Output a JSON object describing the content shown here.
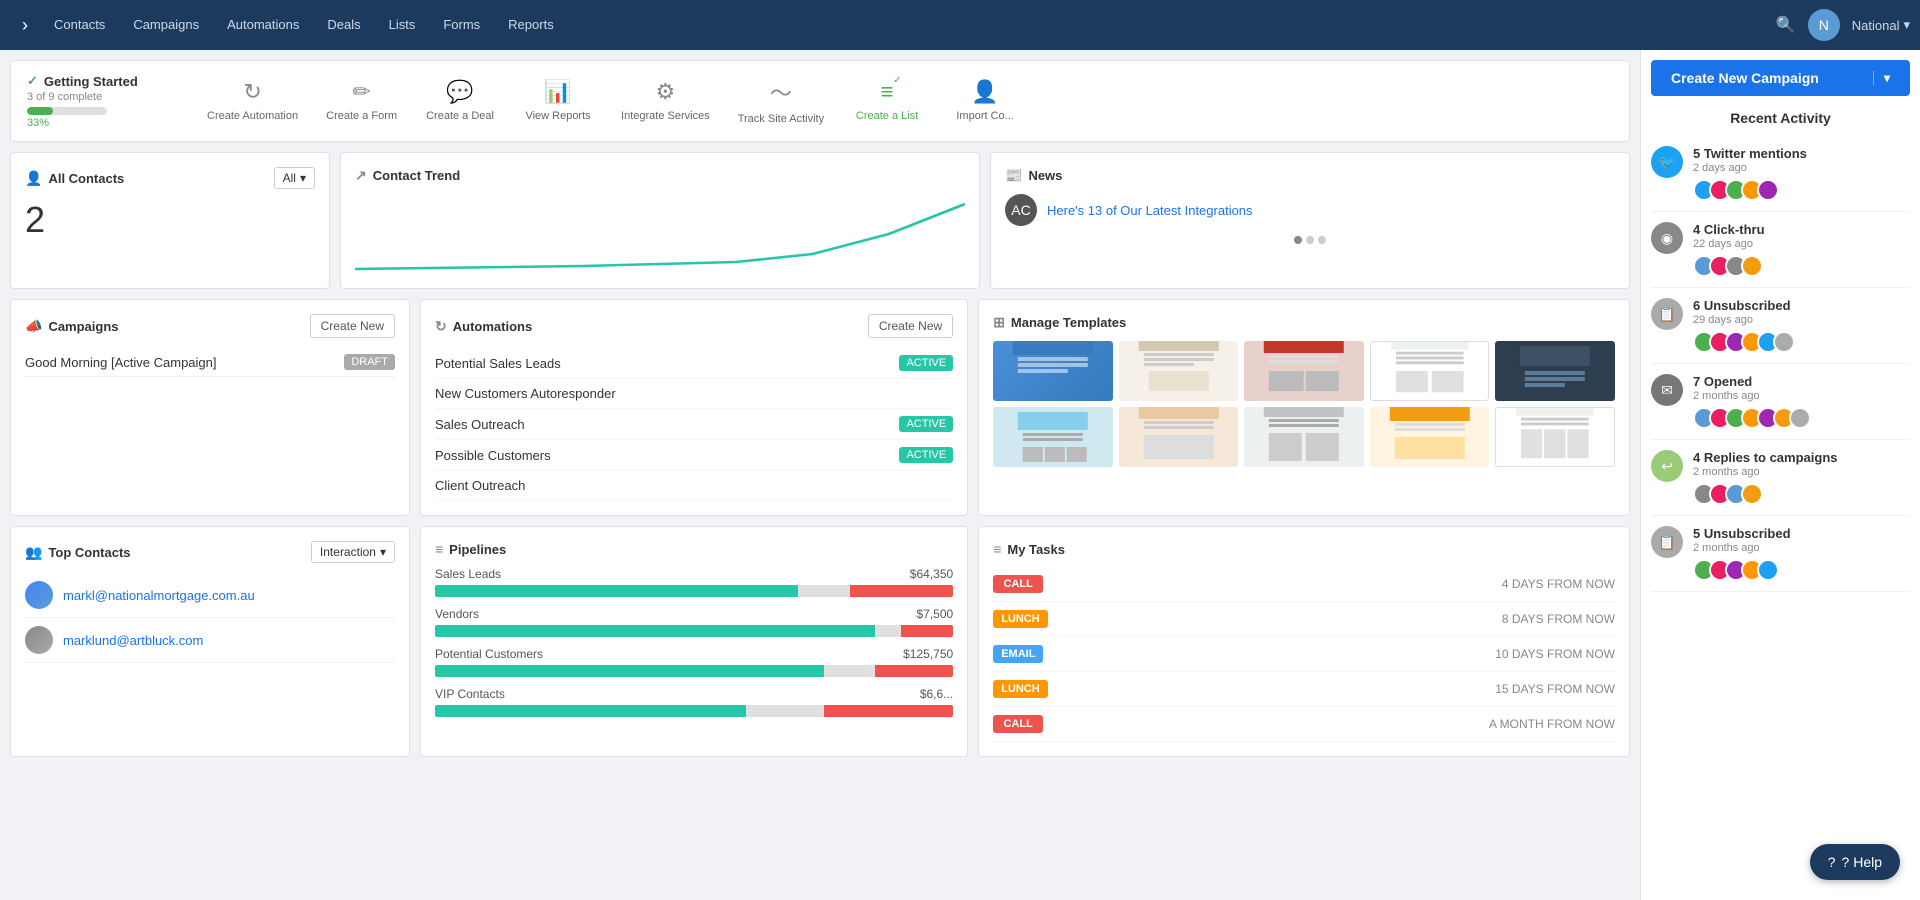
{
  "nav": {
    "toggle_icon": "›",
    "links": [
      "Contacts",
      "Campaigns",
      "Automations",
      "Deals",
      "Lists",
      "Forms",
      "Reports"
    ],
    "org": "National",
    "org_arrow": "▾"
  },
  "getting_started": {
    "title": "Getting Started",
    "progress_text": "3 of 9 complete",
    "progress_pct": 33,
    "progress_label": "33%",
    "steps": [
      {
        "icon": "↻",
        "label": "Create Automation",
        "done": false
      },
      {
        "icon": "✏",
        "label": "Create a Form",
        "done": false
      },
      {
        "icon": "💬",
        "label": "Create a Deal",
        "done": false
      },
      {
        "icon": "📊",
        "label": "View Reports",
        "done": false
      },
      {
        "icon": "⚙",
        "label": "Integrate Services",
        "done": false
      },
      {
        "icon": "〜",
        "label": "Track Site Activity",
        "done": false
      },
      {
        "icon": "≡",
        "label": "Create a List",
        "done": true
      },
      {
        "icon": "👤",
        "label": "Import Co...",
        "done": false
      }
    ]
  },
  "all_contacts": {
    "title": "All Contacts",
    "filter_value": "All",
    "count": "2"
  },
  "contact_trend": {
    "title": "Contact Trend"
  },
  "news": {
    "title": "News",
    "item_text": "Here's 13 of Our Latest Integrations"
  },
  "campaigns": {
    "title": "Campaigns",
    "create_label": "Create New",
    "items": [
      {
        "name": "Good Morning [Active Campaign]",
        "badge": "DRAFT",
        "badge_type": "draft"
      }
    ]
  },
  "automations": {
    "title": "Automations",
    "create_label": "Create New",
    "items": [
      {
        "name": "Potential Sales Leads",
        "badge": "ACTIVE",
        "badge_type": "active"
      },
      {
        "name": "New Customers Autoresponder",
        "badge": "",
        "badge_type": "none"
      },
      {
        "name": "Sales Outreach",
        "badge": "ACTIVE",
        "badge_type": "active"
      },
      {
        "name": "Possible Customers",
        "badge": "ACTIVE",
        "badge_type": "active"
      },
      {
        "name": "Client Outreach",
        "badge": "",
        "badge_type": "none"
      }
    ]
  },
  "manage_templates": {
    "title": "Manage Templates",
    "templates": [
      {
        "color": "#4a90d9",
        "pattern": "blue"
      },
      {
        "color": "#e8e0d0",
        "pattern": "tan"
      },
      {
        "color": "#c0392b",
        "pattern": "red"
      },
      {
        "color": "#ecf0f1",
        "pattern": "light"
      },
      {
        "color": "#2c3e50",
        "pattern": "dark"
      },
      {
        "color": "#87ceeb",
        "pattern": "sky"
      },
      {
        "color": "#e8d5c0",
        "pattern": "peach"
      },
      {
        "color": "#bdc3c7",
        "pattern": "gray"
      },
      {
        "color": "#f39c12",
        "pattern": "orange"
      },
      {
        "color": "#ecf0f1",
        "pattern": "white"
      }
    ]
  },
  "top_contacts": {
    "title": "Top Contacts",
    "filter_value": "Interaction",
    "contacts": [
      {
        "email": "markl@nationalmortgage.com.au",
        "avatar_color": "blue"
      },
      {
        "email": "marklund@artbluck.com",
        "avatar_color": "gray"
      }
    ]
  },
  "pipelines": {
    "title": "Pipelines",
    "items": [
      {
        "name": "Sales Leads",
        "amount": "$64,350",
        "green_pct": 70,
        "red_pct": 20
      },
      {
        "name": "Vendors",
        "amount": "$7,500",
        "green_pct": 85,
        "red_pct": 10
      },
      {
        "name": "Potential Customers",
        "amount": "$125,750",
        "green_pct": 75,
        "red_pct": 15
      },
      {
        "name": "VIP Contacts",
        "amount": "$6,6...",
        "green_pct": 60,
        "red_pct": 25
      }
    ]
  },
  "my_tasks": {
    "title": "My Tasks",
    "tasks": [
      {
        "badge": "CALL",
        "type": "call",
        "when": "4 DAYS FROM NOW"
      },
      {
        "badge": "LUNCH",
        "type": "lunch",
        "when": "8 DAYS FROM NOW"
      },
      {
        "badge": "EMAIL",
        "type": "email",
        "when": "10 DAYS FROM NOW"
      },
      {
        "badge": "LUNCH",
        "type": "lunch",
        "when": "15 DAYS FROM NOW"
      },
      {
        "badge": "CALL",
        "type": "call",
        "when": "A MONTH FROM NOW"
      }
    ]
  },
  "sidebar": {
    "create_campaign_label": "Create New Campaign",
    "create_campaign_arrow": "▾",
    "recent_activity_title": "Recent Activity",
    "activities": [
      {
        "icon": "🐦",
        "icon_type": "twitter",
        "label": "5 Twitter mentions",
        "time": "2 days ago"
      },
      {
        "icon": "◉",
        "icon_type": "clickthru",
        "label": "4 Click-thru",
        "time": "22 days ago"
      },
      {
        "icon": "📋",
        "icon_type": "unsub",
        "label": "6 Unsubscribed",
        "time": "29 days ago"
      },
      {
        "icon": "✉",
        "icon_type": "opened",
        "label": "7 Opened",
        "time": "2 months ago"
      },
      {
        "icon": "↩",
        "icon_type": "reply",
        "label": "4 Replies to campaigns",
        "time": "2 months ago"
      },
      {
        "icon": "📋",
        "icon_type": "unsub2",
        "label": "5 Unsubscribed",
        "time": "2 months ago"
      }
    ]
  },
  "help_btn": "? Help",
  "scroll_btn": "^"
}
